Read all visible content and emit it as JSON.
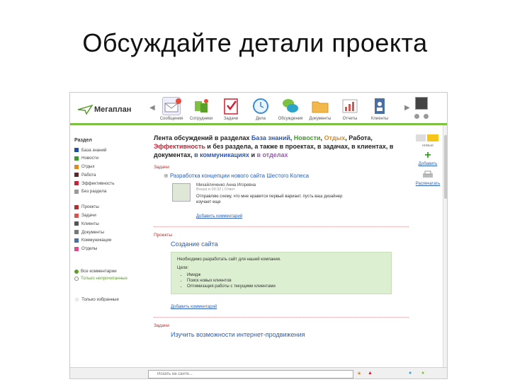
{
  "slide": {
    "title": "Обсуждайте детали проекта"
  },
  "app": {
    "logo_text": "Мегаплан",
    "modules": [
      {
        "label": "Сообщения",
        "icon": "envelope-icon",
        "color": "#e74c3c"
      },
      {
        "label": "Сотрудники",
        "icon": "people-icon",
        "color": "#7cc142"
      },
      {
        "label": "Задачи",
        "icon": "checklist-icon",
        "color": "#cc2233"
      },
      {
        "label": "Дела",
        "icon": "clock-icon",
        "color": "#3a8bd6"
      },
      {
        "label": "Обсуждения",
        "icon": "chat-bubbles-icon",
        "color": "#2ea3c8"
      },
      {
        "label": "Документы",
        "icon": "folder-icon",
        "color": "#e9a93a"
      },
      {
        "label": "Отчеты",
        "icon": "report-chart-icon",
        "color": "#d9534f"
      },
      {
        "label": "Клиенты",
        "icon": "client-card-icon",
        "color": "#4a6fa5"
      }
    ],
    "sidebar": {
      "title": "Раздел",
      "sections": [
        {
          "label": "База знаний",
          "color": "#1f4e9e"
        },
        {
          "label": "Новости",
          "color": "#3c9a2a"
        },
        {
          "label": "Отдых",
          "color": "#e08a1a"
        },
        {
          "label": "Работа",
          "color": "#5a2a2a"
        },
        {
          "label": "Эффективность",
          "color": "#cc2233"
        },
        {
          "label": "Без раздела",
          "color": "#999999"
        }
      ],
      "entities": [
        {
          "label": "Проекты",
          "color": "#b03030"
        },
        {
          "label": "Задачи",
          "color": "#d9534f"
        },
        {
          "label": "Клиенты",
          "color": "#555555"
        },
        {
          "label": "Документы",
          "color": "#777777"
        },
        {
          "label": "Коммуникации",
          "color": "#4a6fa5"
        },
        {
          "label": "Отделы",
          "color": "#e24a8a"
        }
      ],
      "filter_all": "Все комментарии",
      "filter_unread": "Только непрочитанные",
      "favorites": "Только избранные"
    },
    "feed": {
      "head_prefix": "Лента обсуждений в разделах ",
      "sec1": "База знаний",
      "sep1": ", ",
      "sec2": "Новости",
      "sep2": ", ",
      "sec3": "Отдых",
      "sep3": ", ",
      "sec4": "Работа",
      "sep4": ", ",
      "sec5": "Эффективность",
      "mid": " и без раздела, а также в проектах, в задачах, в клиентах, в документах, ",
      "sec6": "в коммуникациях",
      "mid2": " и ",
      "sec7": "в отделах",
      "entries": [
        {
          "section": "Задачи",
          "title": "Разработка концепции нового сайта Шестого Колеса",
          "author": "Михайличенко Анна Игоревна",
          "meta": "Вчера в 09:32 | Ответ",
          "text": "Отправляю схему, что мне нравится первый вариант. пусть ваш дизайнер изучает еще",
          "reply_link": "Добавить комментарий"
        },
        {
          "section": "Проекты",
          "title": "Создание сайта",
          "box_intro": "Необходимо разработать сайт для нашей компании.",
          "goals_label": "Цели:",
          "goals": [
            "Имидж",
            "Поиск новых клиентов",
            "Оптимизация работы с текущими клиентами"
          ],
          "reply_link": "Добавить комментарий"
        },
        {
          "section": "Задачи",
          "title": "Изучить возможности интернет-продвижения"
        }
      ]
    },
    "right_panel": {
      "add_label": "Добавить",
      "print_label": "Распечатать",
      "top_label": "новые"
    },
    "bottom": {
      "search_placeholder": "Искать на сайте..."
    }
  }
}
